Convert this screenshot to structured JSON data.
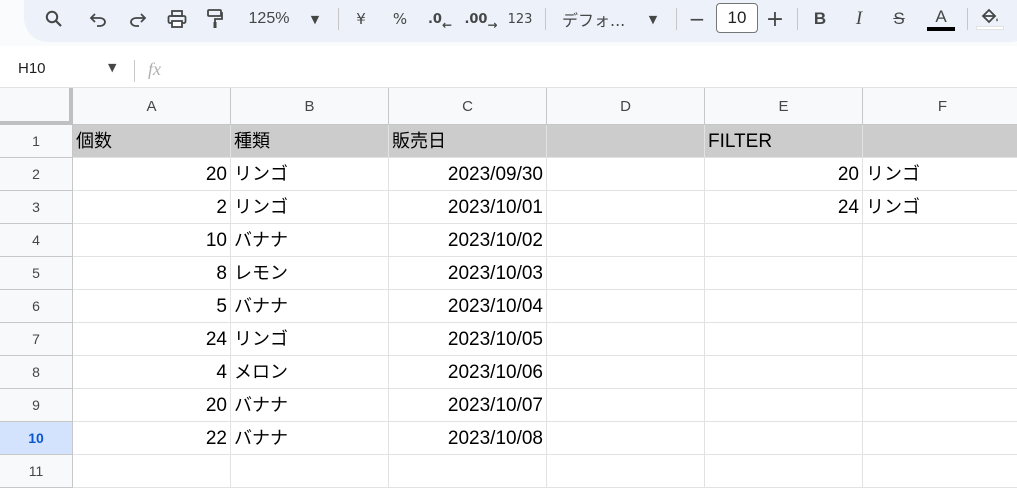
{
  "toolbar": {
    "zoom": "125%",
    "currency": "¥",
    "percent": "%",
    "dec_decrease": ".0",
    "dec_increase": ".00",
    "number_format": "123",
    "font": "デフォ...",
    "font_size": "10",
    "minus": "−",
    "plus": "+",
    "bold": "B",
    "italic": "I",
    "strike": "S",
    "text_color_letter": "A"
  },
  "formula_bar": {
    "name_box": "H10",
    "fx": "fx"
  },
  "columns": [
    "A",
    "B",
    "C",
    "D",
    "E",
    "F"
  ],
  "rows": [
    "1",
    "2",
    "3",
    "4",
    "5",
    "6",
    "7",
    "8",
    "9",
    "10",
    "11"
  ],
  "active_row": "10",
  "headers": {
    "a": "個数",
    "b": "種類",
    "c": "販売日",
    "e": "FILTER"
  },
  "table": [
    {
      "count": "20",
      "kind": "リンゴ",
      "date": "2023/09/30"
    },
    {
      "count": "2",
      "kind": "リンゴ",
      "date": "2023/10/01"
    },
    {
      "count": "10",
      "kind": "バナナ",
      "date": "2023/10/02"
    },
    {
      "count": "8",
      "kind": "レモン",
      "date": "2023/10/03"
    },
    {
      "count": "5",
      "kind": "バナナ",
      "date": "2023/10/04"
    },
    {
      "count": "24",
      "kind": "リンゴ",
      "date": "2023/10/05"
    },
    {
      "count": "4",
      "kind": "メロン",
      "date": "2023/10/06"
    },
    {
      "count": "20",
      "kind": "バナナ",
      "date": "2023/10/07"
    },
    {
      "count": "22",
      "kind": "バナナ",
      "date": "2023/10/08"
    }
  ],
  "filter_results": [
    {
      "count": "20",
      "kind": "リンゴ"
    },
    {
      "count": "24",
      "kind": "リンゴ"
    }
  ],
  "colors": {
    "header_fill": "#cccccc",
    "active_row": "#d3e3fd",
    "toolbar_bg": "#edf2fa"
  }
}
